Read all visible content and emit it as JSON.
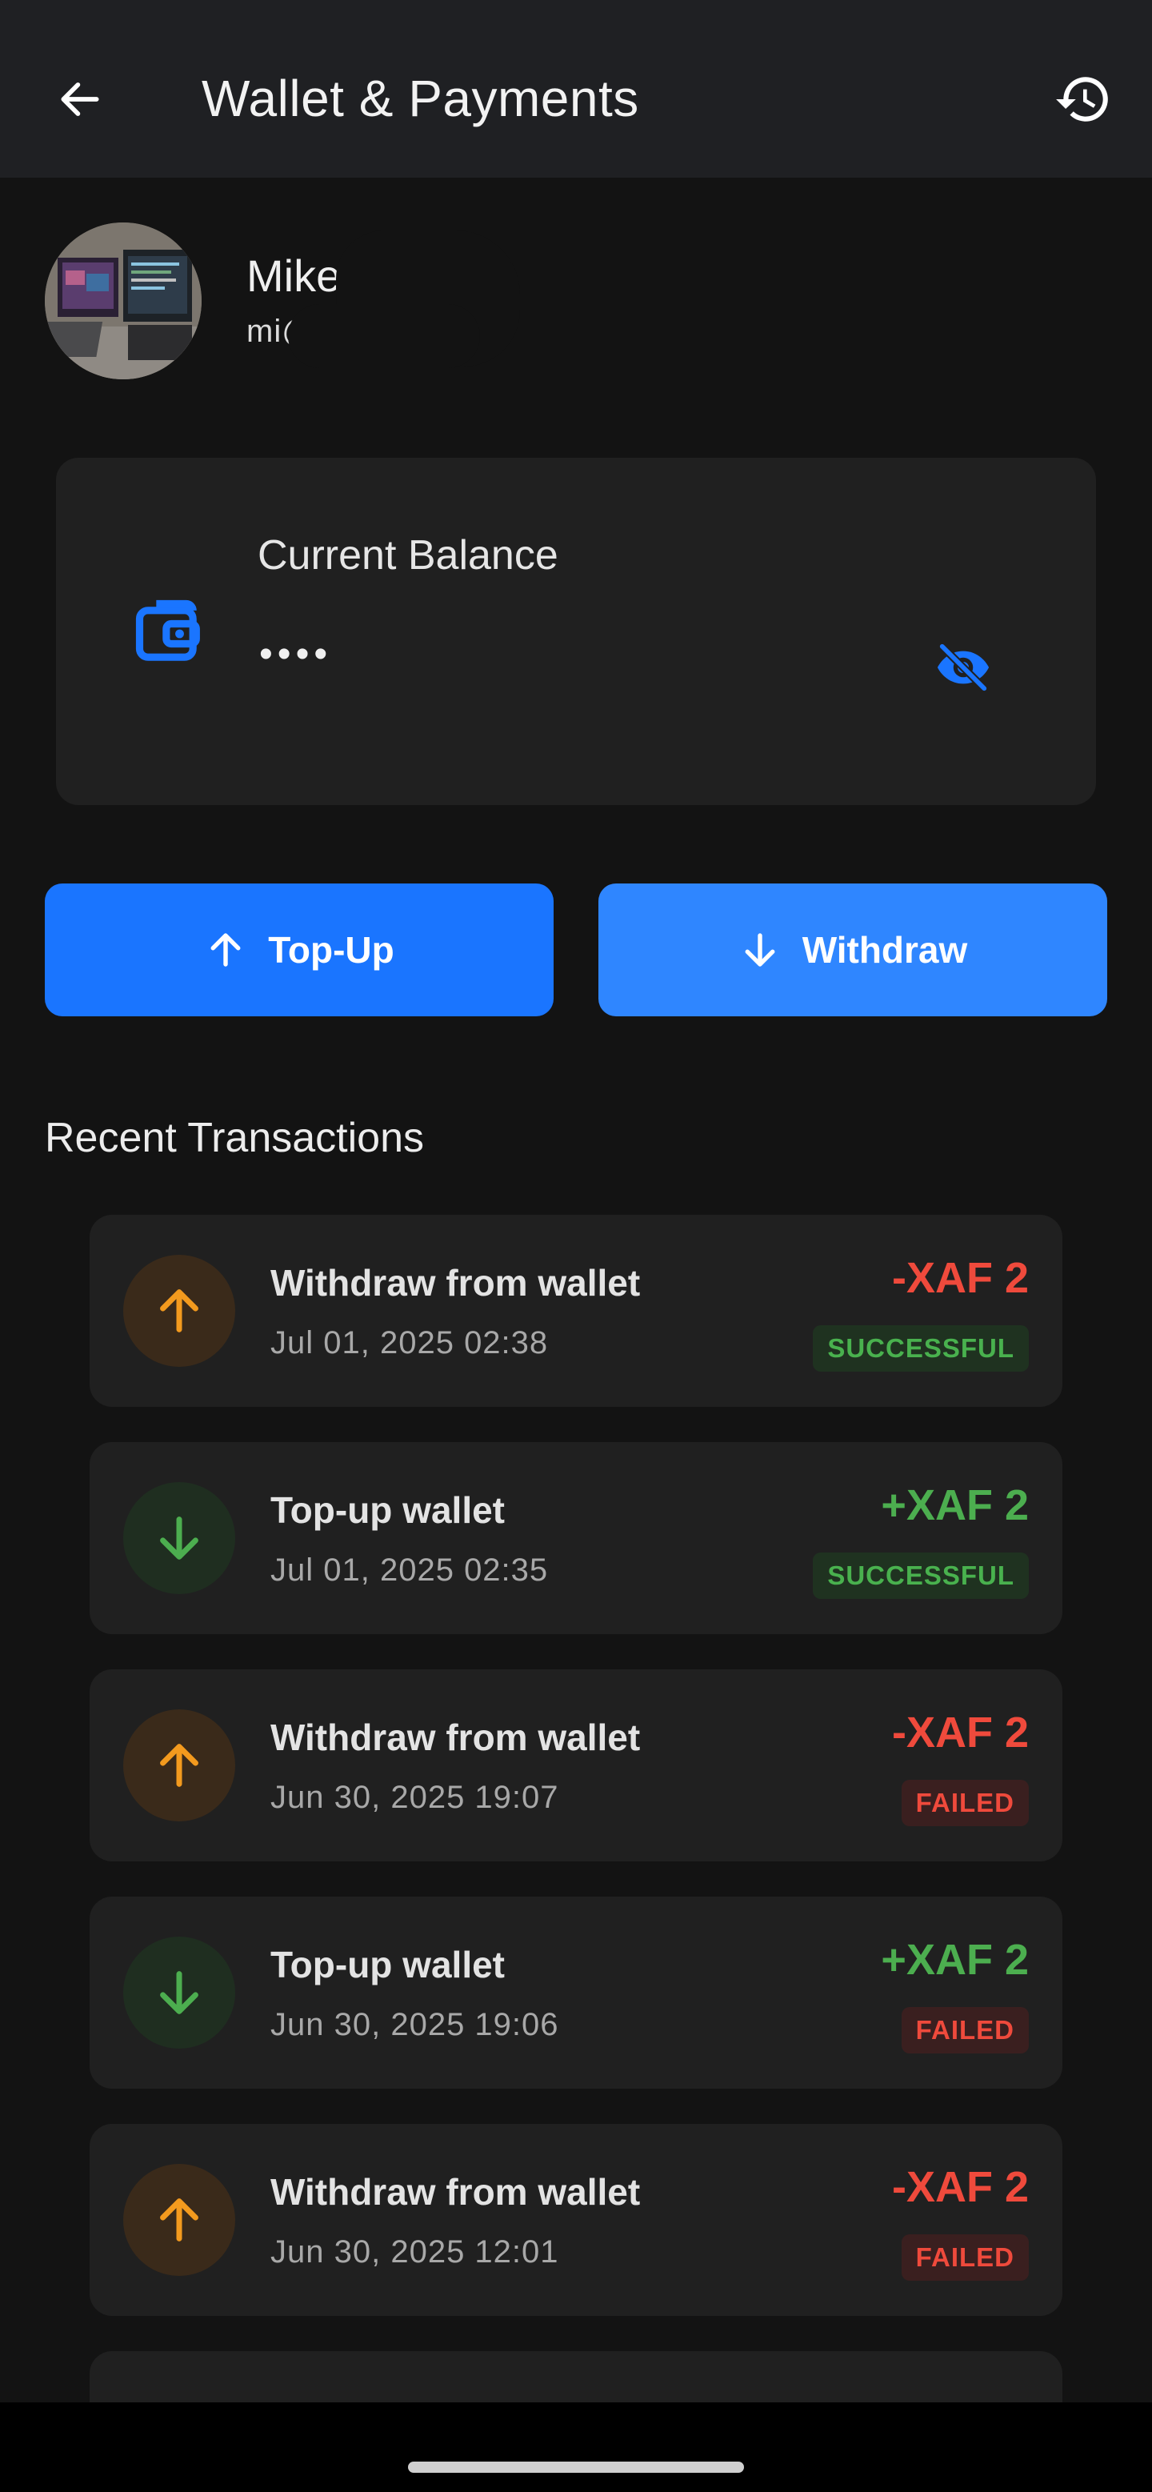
{
  "appbar": {
    "title": "Wallet & Payments",
    "back_icon": "arrow-left-icon",
    "history_icon": "history-icon"
  },
  "profile": {
    "name": "Mike",
    "email": "mi@gmail.com"
  },
  "balance": {
    "label": "Current Balance",
    "masked_value": "••••",
    "wallet_icon": "wallet-icon",
    "visibility_icon": "eye-off-icon"
  },
  "actions": {
    "topup_label": "Top-Up",
    "withdraw_label": "Withdraw"
  },
  "section": {
    "recent_title": "Recent Transactions"
  },
  "transactions": [
    {
      "title": "Withdraw from wallet",
      "date": "Jul 01, 2025 02:38",
      "amount": "-XAF 2",
      "status": "SUCCESSFUL",
      "direction": "up"
    },
    {
      "title": "Top-up wallet",
      "date": "Jul 01, 2025 02:35",
      "amount": "+XAF 2",
      "status": "SUCCESSFUL",
      "direction": "down"
    },
    {
      "title": "Withdraw from wallet",
      "date": "Jun 30, 2025 19:07",
      "amount": "-XAF 2",
      "status": "FAILED",
      "direction": "up"
    },
    {
      "title": "Top-up wallet",
      "date": "Jun 30, 2025 19:06",
      "amount": "+XAF 2",
      "status": "FAILED",
      "direction": "down"
    },
    {
      "title": "Withdraw from wallet",
      "date": "Jun 30, 2025 12:01",
      "amount": "-XAF 2",
      "status": "FAILED",
      "direction": "up"
    }
  ],
  "colors": {
    "accent": "#1a75ff",
    "negative": "#ef4a3c",
    "positive": "#4cae4f",
    "withdraw_icon": "#f39a1e"
  }
}
